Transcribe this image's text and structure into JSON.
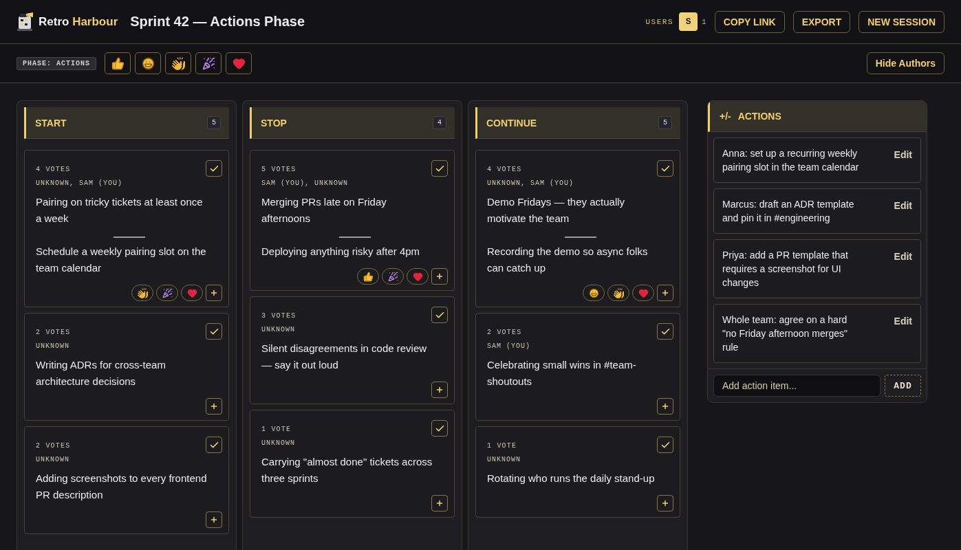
{
  "app": {
    "name_part1": "Retro",
    "name_part2": "Harbour"
  },
  "session_title": "Sprint 42 — Actions Phase",
  "users": {
    "label": "USERS",
    "avatars": [
      {
        "initial": "S"
      }
    ],
    "count": "1"
  },
  "header_buttons": [
    "COPY LINK",
    "EXPORT",
    "NEW SESSION"
  ],
  "phase_badge": "PHASE: ACTIONS",
  "reaction_palette": [
    {
      "kind": "thumbs_up"
    },
    {
      "kind": "laugh"
    },
    {
      "kind": "clap"
    },
    {
      "kind": "party"
    },
    {
      "kind": "heart"
    }
  ],
  "hide_authors_button": "Hide Authors",
  "columns": [
    {
      "title": "START",
      "count": "5",
      "cards": [
        {
          "votes": "4 VOTES",
          "authors": "UNKNOWN, SAM (YOU)",
          "text": "Pairing on tricky tickets at least once a week",
          "action": "Schedule a weekly pairing slot on the team calendar",
          "checked": true,
          "reactions": [
            {
              "kind": "clap"
            },
            {
              "kind": "party"
            },
            {
              "kind": "heart"
            }
          ]
        },
        {
          "votes": "2 VOTES",
          "authors": "UNKNOWN",
          "text": "Writing ADRs for cross-team architecture decisions",
          "checked": true
        },
        {
          "votes": "2 VOTES",
          "authors": "UNKNOWN",
          "text": "Adding screenshots to every frontend PR description",
          "checked": true
        }
      ]
    },
    {
      "title": "STOP",
      "count": "4",
      "cards": [
        {
          "votes": "5 VOTES",
          "authors": "SAM (YOU), UNKNOWN",
          "text": "Merging PRs late on Friday afternoons",
          "action": "Deploying anything risky after 4pm",
          "checked": true,
          "reactions": [
            {
              "kind": "thumbs_up"
            },
            {
              "kind": "party"
            },
            {
              "kind": "heart"
            }
          ]
        },
        {
          "votes": "3 VOTES",
          "authors": "UNKNOWN",
          "text": "Silent disagreements in code review — say it out loud",
          "checked": true
        },
        {
          "votes": "1 VOTE",
          "authors": "UNKNOWN",
          "text": "Carrying \"almost done\" tickets across three sprints",
          "checked": true
        }
      ]
    },
    {
      "title": "CONTINUE",
      "count": "5",
      "cards": [
        {
          "votes": "4 VOTES",
          "authors": "UNKNOWN, SAM (YOU)",
          "text": "Demo Fridays — they actually motivate the team",
          "action": "Recording the demo so async folks can catch up",
          "checked": true,
          "reactions": [
            {
              "kind": "laugh"
            },
            {
              "kind": "clap"
            },
            {
              "kind": "heart"
            }
          ]
        },
        {
          "votes": "2 VOTES",
          "authors": "SAM (YOU)",
          "text": "Celebrating small wins in #team-shoutouts",
          "checked": true
        },
        {
          "votes": "1 VOTE",
          "authors": "UNKNOWN",
          "text": "Rotating who runs the daily stand-up",
          "checked": true
        }
      ]
    }
  ],
  "actions_panel": {
    "icon_text": "+/-",
    "title": "ACTIONS",
    "items": [
      {
        "text": "Anna: set up a recurring weekly pairing slot in the team calendar",
        "edit": "Edit"
      },
      {
        "text": "Marcus: draft an ADR template and pin it in #engineering",
        "edit": "Edit"
      },
      {
        "text": "Priya: add a PR template that requires a screenshot for UI changes",
        "edit": "Edit"
      },
      {
        "text": "Whole team: agree on a hard \"no Friday afternoon merges\" rule",
        "edit": "Edit"
      }
    ],
    "input": {
      "placeholder": "Add action item..."
    },
    "add_button": "ADD"
  }
}
